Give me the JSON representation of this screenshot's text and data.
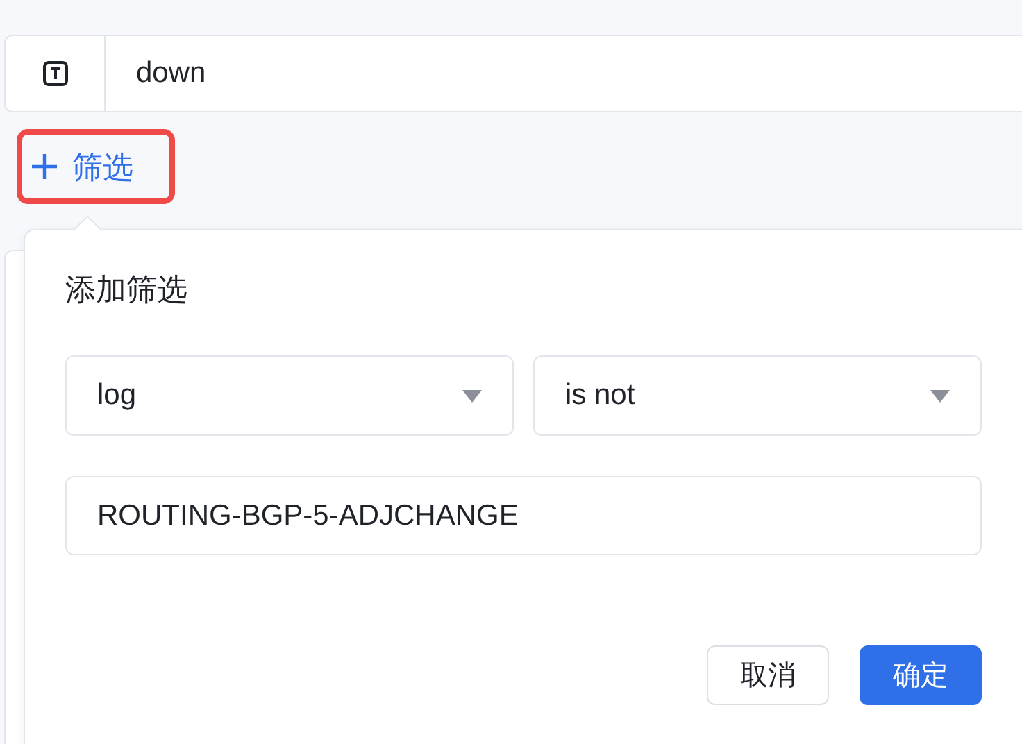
{
  "search": {
    "value": "down"
  },
  "add_filter_button": {
    "label": "筛选",
    "highlighted": true
  },
  "popover": {
    "title": "添加筛选",
    "field_select": {
      "value": "log"
    },
    "operator_select": {
      "value": "is not"
    },
    "value_input": {
      "value": "ROUTING-BGP-5-ADJCHANGE"
    },
    "buttons": [
      {
        "label": "取消",
        "kind": "secondary"
      },
      {
        "label": "确定",
        "kind": "primary"
      }
    ]
  }
}
